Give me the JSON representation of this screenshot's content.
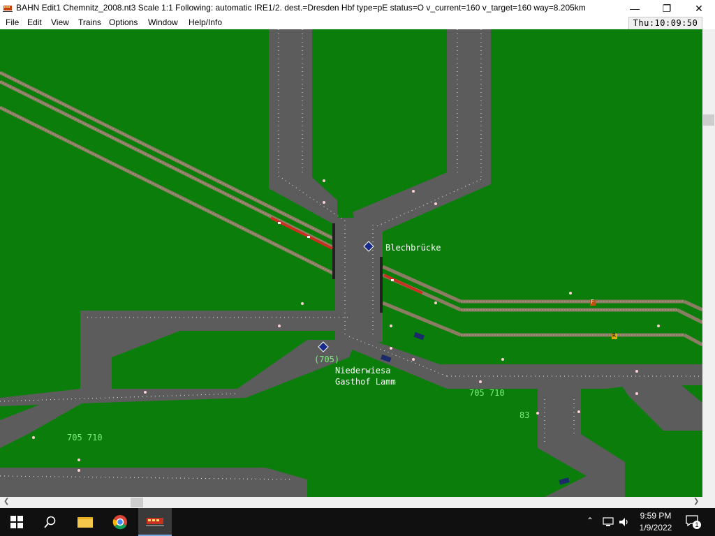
{
  "window": {
    "title": "BAHN Edit1 Chemnitz_2008.nt3 Scale 1:1 Following: automatic IRE1/2.  dest.=Dresden Hbf type=pE status=O  v_current=160 v_target=160 way=8.205km",
    "minimize_icon": "minimize-icon",
    "maximize_icon": "restore-icon",
    "close_icon": "close-icon"
  },
  "menu": {
    "items": [
      "File",
      "Edit",
      "View",
      "Trains",
      "Options",
      "Window",
      "Help/Info"
    ],
    "clock": "Thu:10:09:50"
  },
  "map": {
    "colors": {
      "background": "#0a7d0a",
      "road": "#5c5c5c",
      "track": "#8c7c64",
      "label_white": "#ffffff",
      "label_green": "#7cf07c"
    },
    "stations": [
      {
        "name": "Blechbrücke"
      },
      {
        "name": "Niederwiesa"
      },
      {
        "name": "Gasthof Lamm"
      }
    ],
    "route_labels": {
      "stop_routes": "(705)",
      "east_routes": "705 710",
      "route_83": "83",
      "west_routes": "705 710"
    },
    "track_markers": [
      "F",
      "R"
    ]
  },
  "taskbar": {
    "apps": [
      "start-icon",
      "search-icon",
      "file-explorer-icon",
      "chrome-icon",
      "bahn-app-icon"
    ],
    "tray": {
      "time": "9:59 PM",
      "date": "1/9/2022",
      "notification_count": "1"
    }
  }
}
